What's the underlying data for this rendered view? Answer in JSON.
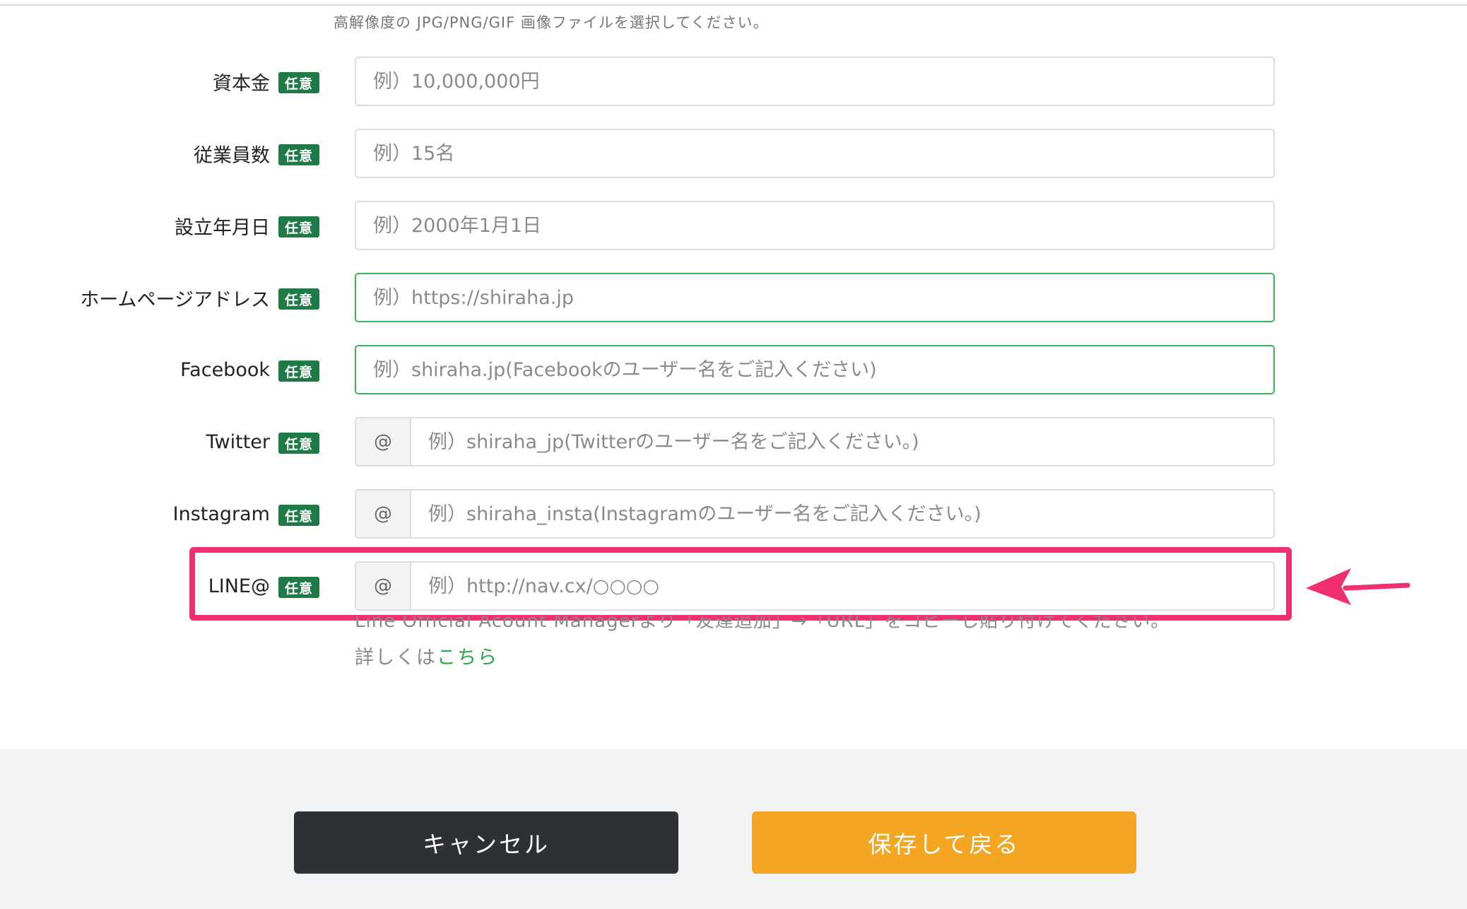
{
  "image_hint": "高解像度の JPG/PNG/GIF 画像ファイルを選択してください。",
  "badge_text": "任意",
  "fields": [
    {
      "label": "資本金",
      "placeholder": "例）10,000,000円"
    },
    {
      "label": "従業員数",
      "placeholder": "例）15名"
    },
    {
      "label": "設立年月日",
      "placeholder": "例）2000年1月1日"
    },
    {
      "label": "ホームページアドレス",
      "placeholder": "例）https://shiraha.jp"
    },
    {
      "label": "Facebook",
      "placeholder": "例）shiraha.jp(Facebookのユーザー名をご記入ください)"
    },
    {
      "label": "Twitter",
      "prefix": "@",
      "placeholder": "例）shiraha_jp(Twitterのユーザー名をご記入ください。)"
    },
    {
      "label": "Instagram",
      "prefix": "@",
      "placeholder": "例）shiraha_insta(Instagramのユーザー名をご記入ください。)"
    },
    {
      "label": "LINE@",
      "prefix": "@",
      "placeholder": "例）http://nav.cx/○○○○"
    }
  ],
  "line_help": "Line Official Acount Managerより「友達追加」→「URL」をコピーし貼り付けてください。",
  "detail_prefix": "詳しくは",
  "detail_link": "こちら",
  "buttons": {
    "cancel": "キャンセル",
    "save": "保存して戻る"
  },
  "colors": {
    "badge": "#1e7a46",
    "highlight": "#f0306e",
    "cancel_button": "#2d3035",
    "save_button": "#f4a623",
    "link": "#2aa84a",
    "focused_border": "#3cb35a"
  }
}
